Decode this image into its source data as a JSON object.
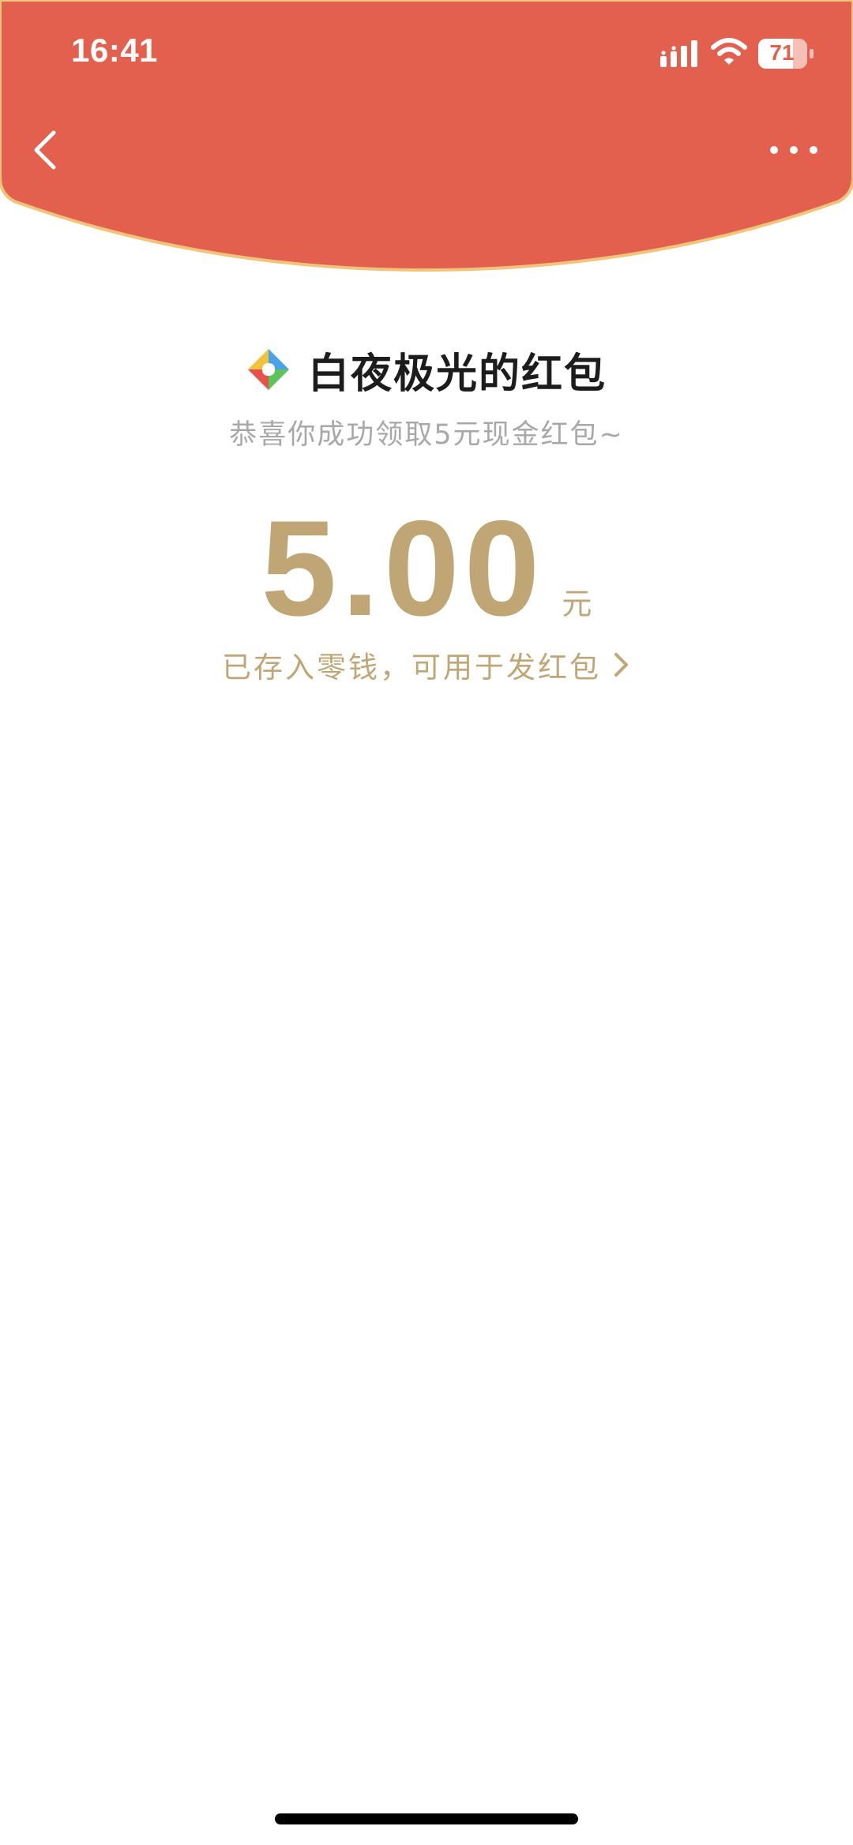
{
  "status_bar": {
    "time": "16:41",
    "battery": "71",
    "icons": [
      "signal-icon",
      "wifi-icon",
      "battery-icon"
    ]
  },
  "nav": {
    "back_icon": "chevron-left-icon",
    "more_icon": "more-dots-icon"
  },
  "sender": {
    "name": "白夜极光的红包",
    "avatar_icon": "colorful-diamond-logo"
  },
  "subtitle": "恭喜你成功领取5元现金红包~",
  "amount": {
    "value": "5.00",
    "unit": "元"
  },
  "wallet_link": {
    "text": "已存入零钱，可用于发红包",
    "icon": "chevron-right-icon"
  },
  "colors": {
    "header_red": "#e2604d",
    "header_border": "#f2c47a",
    "gold": "#c0a674",
    "subtitle_gray": "#a8a8a8"
  }
}
